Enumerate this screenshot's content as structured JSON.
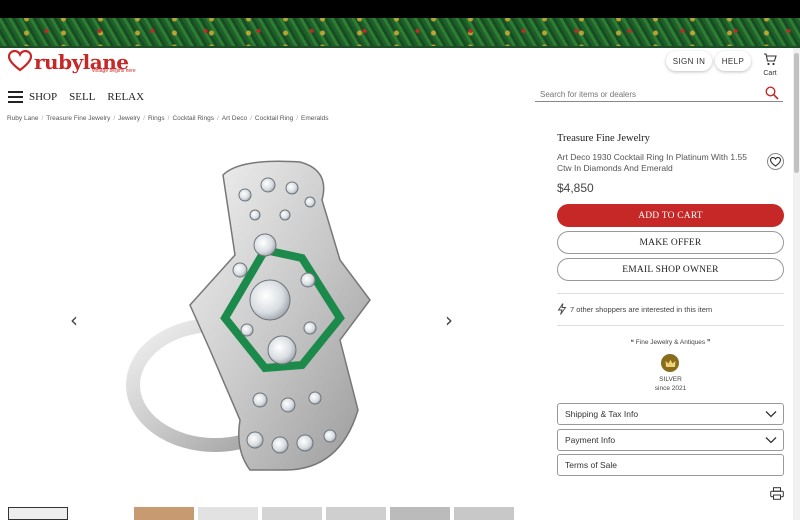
{
  "brand": {
    "name": "rubylane",
    "tagline": "vintage begins here",
    "accent": "#c62828"
  },
  "header": {
    "signin_label": "SIGN IN",
    "help_label": "HELP",
    "cart_label": "Cart",
    "nav": [
      "SHOP",
      "SELL",
      "RELAX"
    ],
    "search_placeholder": "Search for items or dealers"
  },
  "breadcrumb": [
    "Ruby Lane",
    "Treasure Fine Jewelry",
    "Jewelry",
    "Rings",
    "Cocktail Rings",
    "Art Deco",
    "Cocktail Ring",
    "Emeralds"
  ],
  "item": {
    "seller": "Treasure Fine Jewelry",
    "title": "Art Deco 1930 Cocktail Ring In Platinum With 1.55 Ctw In Diamonds And Emerald",
    "price": "$4,850"
  },
  "actions": {
    "add_to_cart": "ADD TO CART",
    "make_offer": "MAKE OFFER",
    "email_owner": "EMAIL SHOP OWNER"
  },
  "interest_text": "7 other shoppers are interested in this item",
  "shop": {
    "name": "❝ Fine Jewelry & Antiques ❞",
    "level": "SILVER",
    "since": "since 2021"
  },
  "accordions": [
    {
      "label": "Shipping & Tax Info",
      "expandable": true
    },
    {
      "label": "Payment Info",
      "expandable": true
    },
    {
      "label": "Terms of Sale",
      "expandable": false
    }
  ],
  "gallery": {
    "prev_icon": "chevron-left-icon",
    "next_icon": "chevron-right-icon"
  }
}
